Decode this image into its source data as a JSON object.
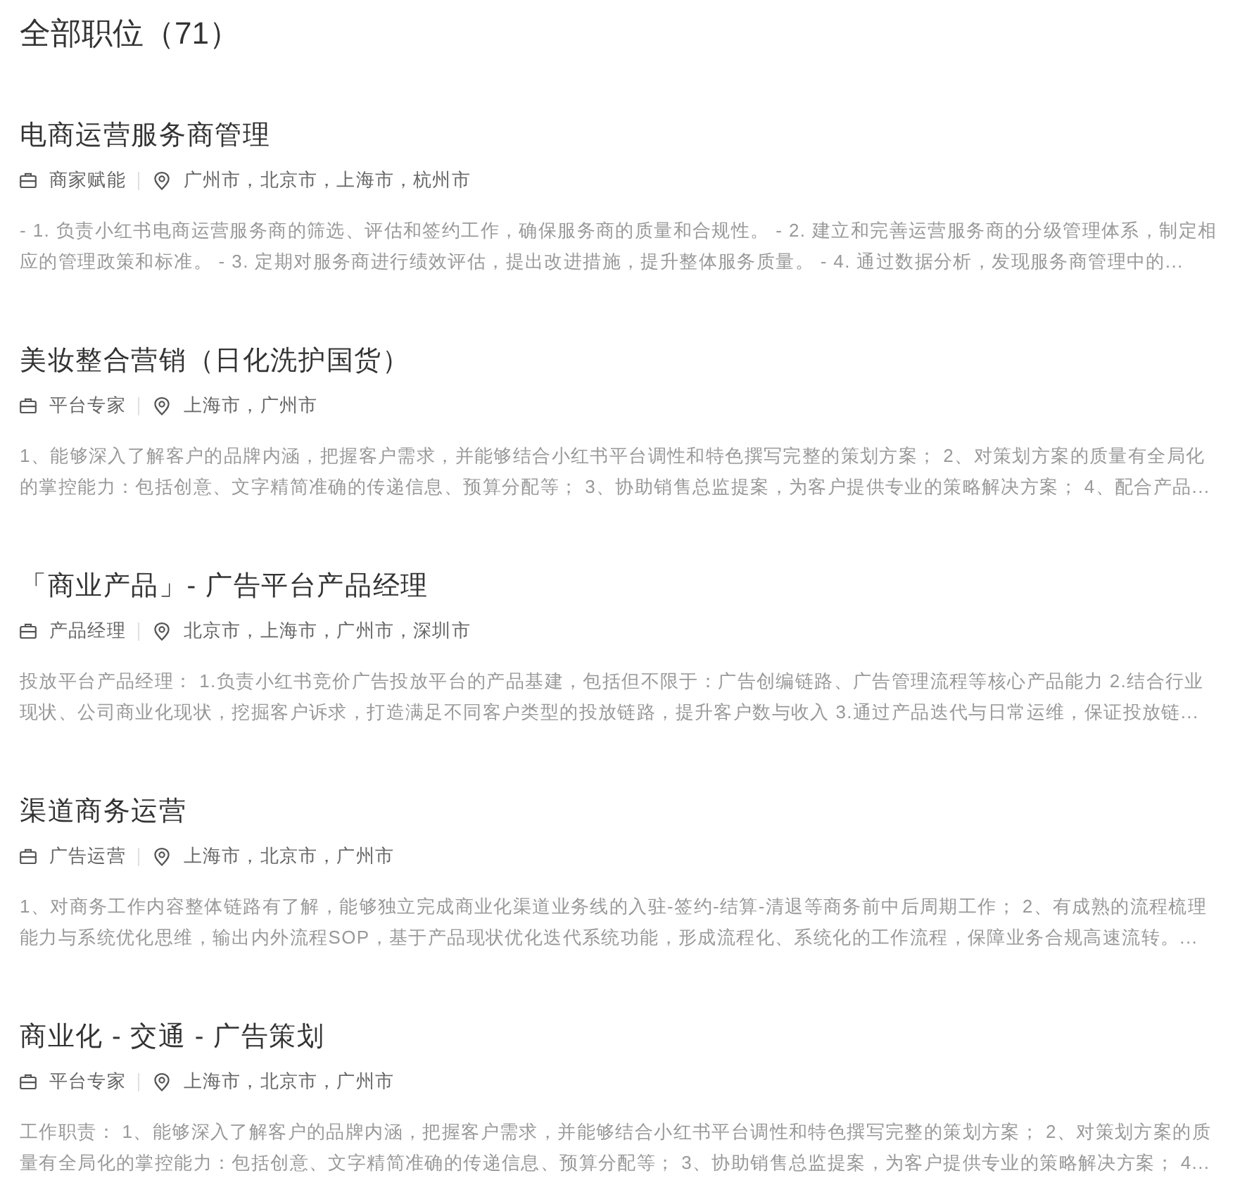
{
  "page_title": "全部职位（71）",
  "jobs": [
    {
      "title": "电商运营服务商管理",
      "category": "商家赋能",
      "locations": "广州市，北京市，上海市，杭州市",
      "description": "- 1. 负责小红书电商运营服务商的筛选、评估和签约工作，确保服务商的质量和合规性。 - 2. 建立和完善运营服务商的分级管理体系，制定相应的管理政策和标准。 - 3. 定期对服务商进行绩效评估，提出改进措施，提升整体服务质量。 - 4. 通过数据分析，发现服务商管理中的..."
    },
    {
      "title": "美妆整合营销（日化洗护国货）",
      "category": "平台专家",
      "locations": "上海市，广州市",
      "description": "1、能够深入了解客户的品牌内涵，把握客户需求，并能够结合小红书平台调性和特色撰写完整的策划方案； 2、对策划方案的质量有全局化的掌控能力：包括创意、文字精简准确的传递信息、预算分配等； 3、协助销售总监提案，为客户提供专业的策略解决方案； 4、配合产品..."
    },
    {
      "title": "「商业产品」- 广告平台产品经理",
      "category": "产品经理",
      "locations": "北京市，上海市，广州市，深圳市",
      "description": "投放平台产品经理： 1.负责小红书竞价广告投放平台的产品基建，包括但不限于：广告创编链路、广告管理流程等核心产品能力 2.结合行业现状、公司商业化现状，挖掘客户诉求，打造满足不同客户类型的投放链路，提升客户数与收入 3.通过产品迭代与日常运维，保证投放链..."
    },
    {
      "title": "渠道商务运营",
      "category": "广告运营",
      "locations": "上海市，北京市，广州市",
      "description": "1、对商务工作内容整体链路有了解，能够独立完成商业化渠道业务线的入驻-签约-结算-清退等商务前中后周期工作； 2、有成熟的流程梳理能力与系统优化思维，输出内外流程SOP，基于产品现状优化迭代系统功能，形成流程化、系统化的工作流程，保障业务合规高速流转。..."
    },
    {
      "title": "商业化 - 交通 - 广告策划",
      "category": "平台专家",
      "locations": "上海市，北京市，广州市",
      "description": "工作职责： 1、能够深入了解客户的品牌内涵，把握客户需求，并能够结合小红书平台调性和特色撰写完整的策划方案； 2、对策划方案的质量有全局化的掌控能力：包括创意、文字精简准确的传递信息、预算分配等； 3、协助销售总监提案，为客户提供专业的策略解决方案； 4..."
    }
  ]
}
